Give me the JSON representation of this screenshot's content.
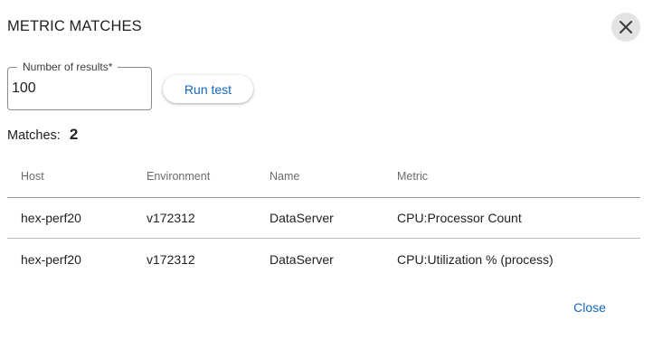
{
  "dialog": {
    "title": "METRIC MATCHES",
    "close_icon": "close-icon"
  },
  "form": {
    "results_label": "Number of results*",
    "results_value": "100",
    "run_label": "Run test"
  },
  "summary": {
    "matches_label": "Matches:",
    "matches_count": "2"
  },
  "table": {
    "columns": [
      "Host",
      "Environment",
      "Name",
      "Metric"
    ],
    "rows": [
      [
        "hex-perf20",
        "v172312",
        "DataServer",
        "CPU:Processor Count"
      ],
      [
        "hex-perf20",
        "v172312",
        "DataServer",
        "CPU:Utilization % (process)"
      ]
    ]
  },
  "footer": {
    "close_label": "Close"
  },
  "colors": {
    "accent": "#1565c0",
    "icon_bg": "#e3e3e3"
  }
}
